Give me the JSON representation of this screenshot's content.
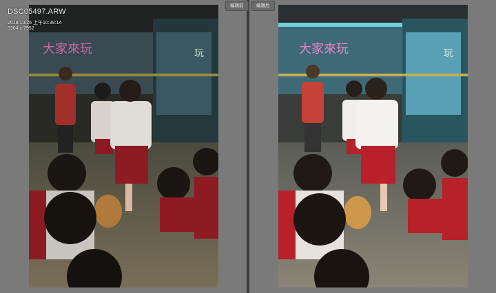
{
  "file_info": {
    "name": "DSC05497.ARW",
    "datetime": "2018/10/26 上午10:39:14",
    "dimensions": "5304 x 7952"
  },
  "compare": {
    "before_label": "编辑前",
    "after_label": "编辑后"
  },
  "photo": {
    "banner_text": "大家來玩",
    "banner_side_text": "玩"
  },
  "colors": {
    "background": "#575757",
    "pane": "#7a7a7a",
    "uniform_red": "#b8202a",
    "uniform_white": "#f2f2f2"
  }
}
